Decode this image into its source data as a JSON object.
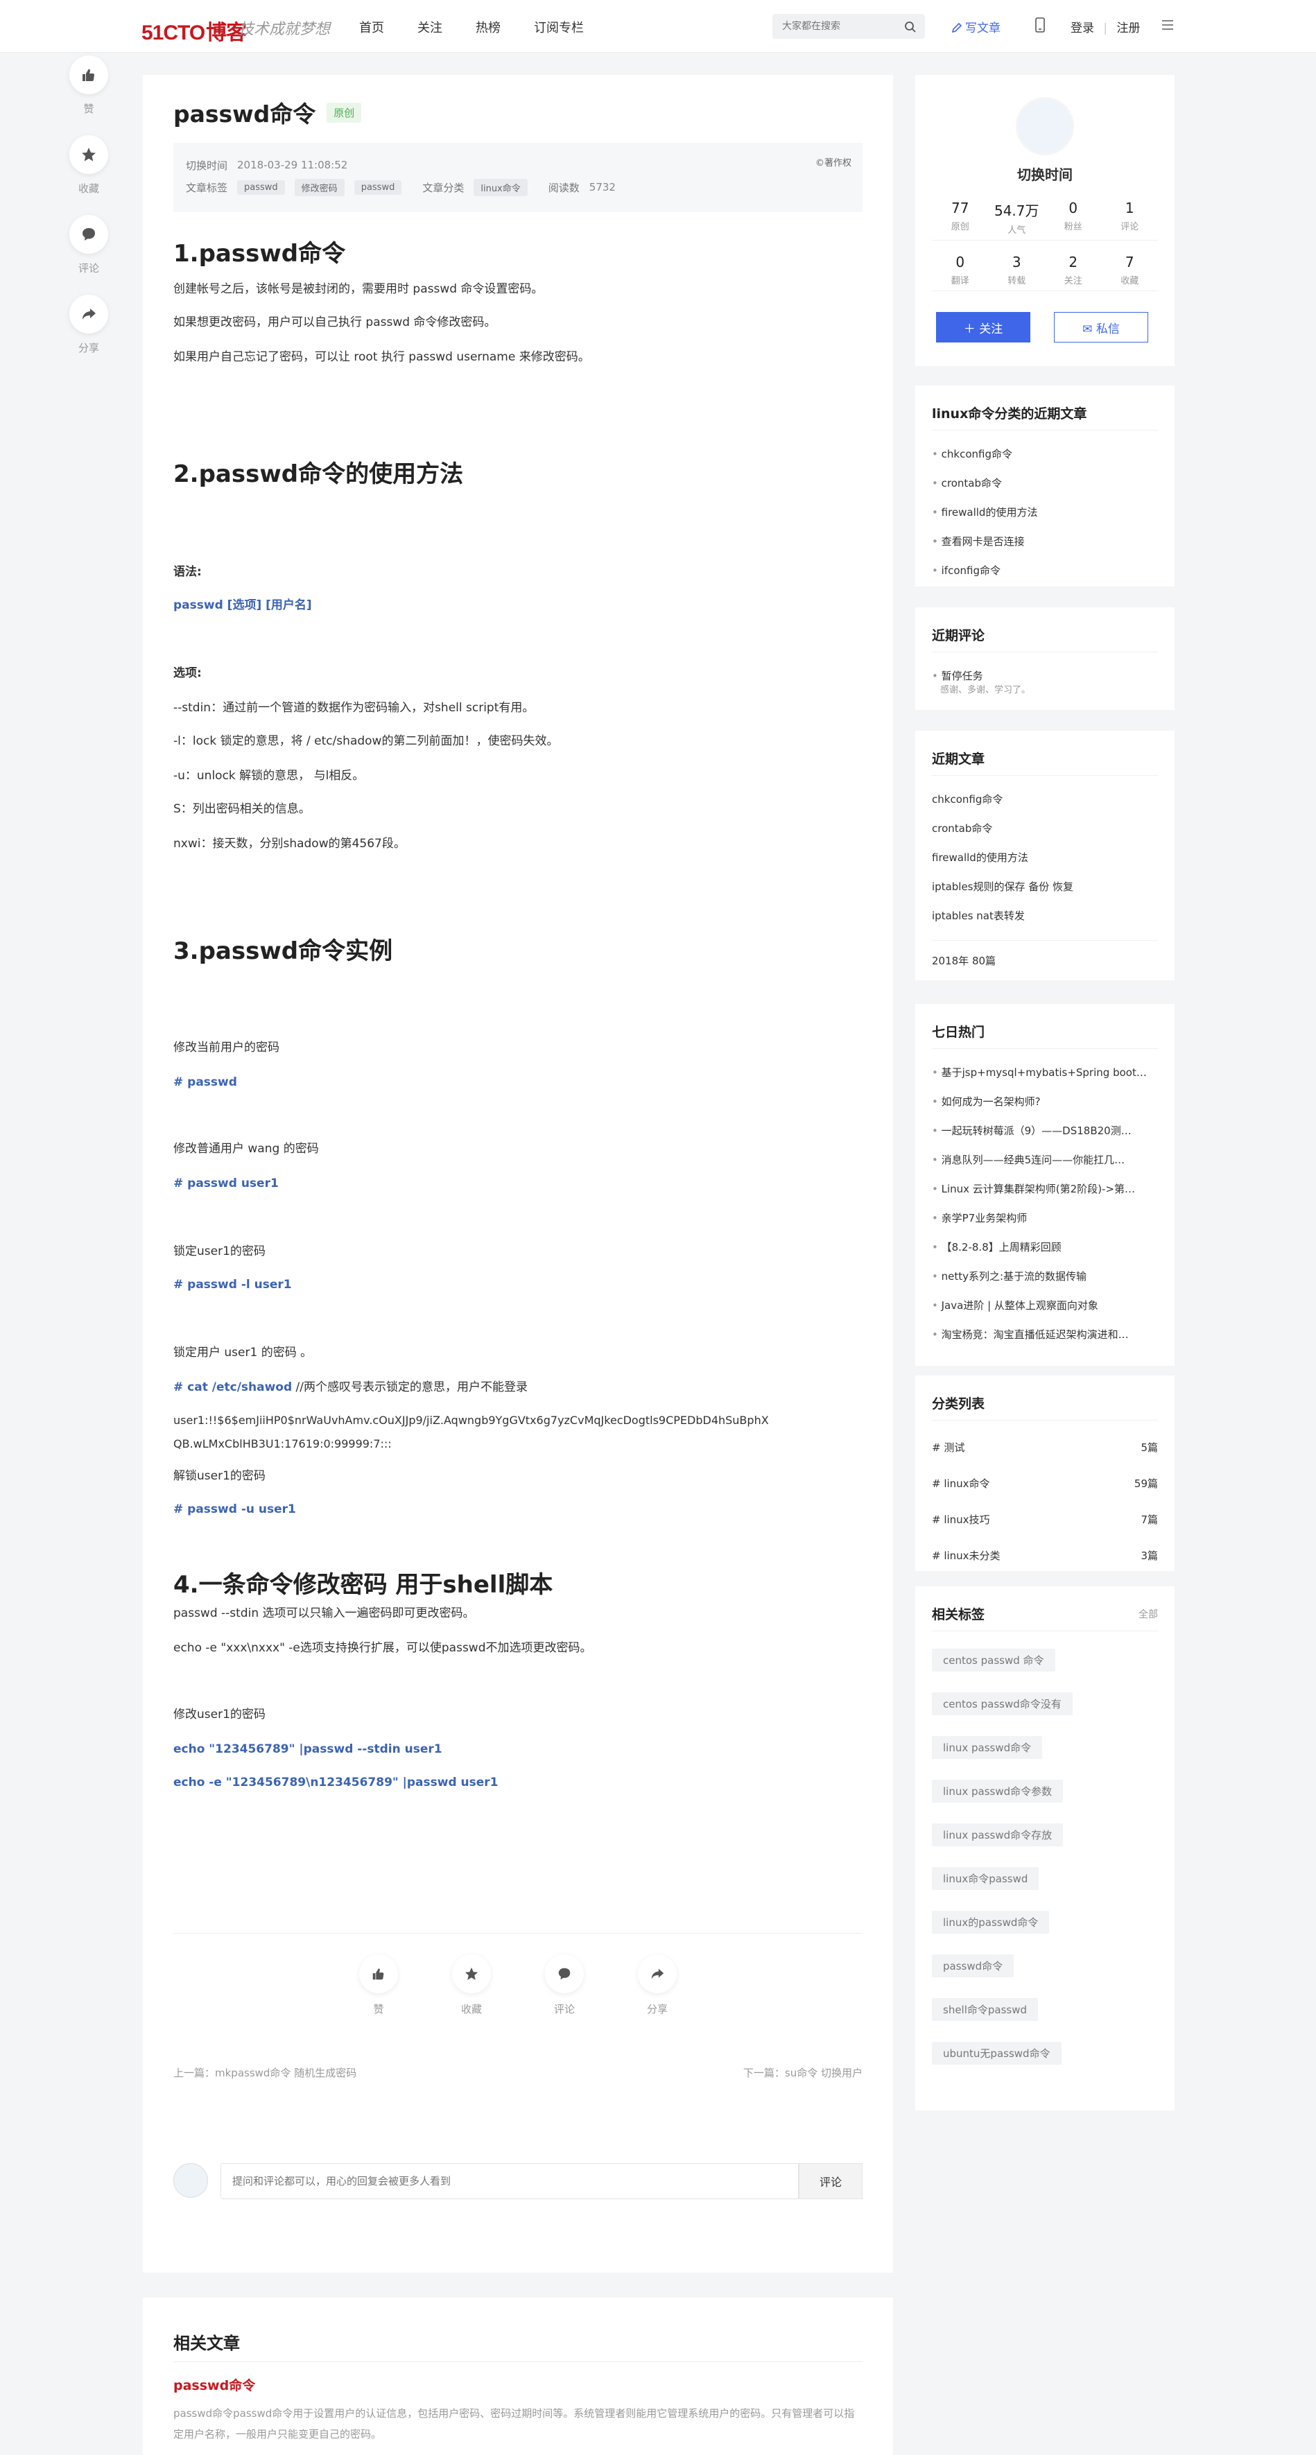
{
  "header": {
    "logo_text": "51CTO",
    "logo_suffix": "博客",
    "slogan": "技术成就梦想",
    "nav": [
      "首页",
      "关注",
      "热榜",
      "订阅专栏"
    ],
    "search_placeholder": "大家都在搜索",
    "write_label": "写文章",
    "login": "登录",
    "register": "注册"
  },
  "left_actions": [
    "赞",
    "收藏",
    "评论",
    "分享"
  ],
  "article": {
    "title": "passwd命令",
    "badge": "原创",
    "meta": {
      "time_label": "切换时间",
      "time_value": "2018-03-29 11:08:52",
      "copyright": "©著作权",
      "tags_label": "文章标签",
      "tags": [
        "passwd",
        "修改密码",
        "passwd"
      ],
      "category_label": "文章分类",
      "category": "linux命令",
      "reads_label": "阅读数",
      "reads": "5732"
    },
    "s1": {
      "h": "1.passwd命令",
      "p1": "创建帐号之后，该帐号是被封闭的，需要用时 passwd 命令设置密码。",
      "p2": "如果想更改密码，用户可以自己执行 passwd 命令修改密码。",
      "p3": "如果用户自己忘记了密码，可以让 root 执行 passwd username 来修改密码。"
    },
    "s2": {
      "h": "2.passwd命令的使用方法",
      "syntax_label": "语法:",
      "syntax": "passwd [选项] [用户名]",
      "options_label": "选项:",
      "o1": "--stdin：通过前一个管道的数据作为密码输入，对shell script有用。",
      "o2": "-l：lock 锁定的意思，将 / etc/shadow的第二列前面加！，使密码失效。",
      "o3": "-u：unlock 解锁的意思， 与l相反。",
      "o4": "S：列出密码相关的信息。",
      "o5": "nxwi：接天数，分别shadow的第4567段。"
    },
    "s3": {
      "h": "3.passwd命令实例",
      "e1": "修改当前用户的密码",
      "c1": "# passwd",
      "e2": "修改普通用户 wang 的密码",
      "c2": "# passwd user1",
      "e3": "锁定user1的密码",
      "c3": "# passwd -l user1",
      "e4": "锁定用户 user1 的密码 。",
      "c4": "# cat /etc/shawod",
      "c4_note": " //两个感叹号表示锁定的意思，用户不能登录",
      "hash1": "user1:!!$6$emJiiHP0$nrWaUvhAmv.cOuXJJp9/jiZ.Aqwngb9YgGVtx6g7yzCvMqJkecDogtls9CPEDbD4hSuBphX",
      "hash2": "QB.wLMxCblHB3U1:17619:0:99999:7:::",
      "e5": "解锁user1的密码",
      "c5": "# passwd -u user1"
    },
    "s4": {
      "h": "4.一条命令修改密码 用于shell脚本",
      "p1": "passwd --stdin 选项可以只输入一遍密码即可更改密码。",
      "p2": "echo -e \"xxx\\nxxx\" -e选项支持换行扩展，可以使passwd不加选项更改密码。",
      "e1": "修改user1的密码",
      "c1": "echo \"123456789\" |passwd --stdin user1",
      "c2": "echo -e \"123456789\\n123456789\" |passwd user1"
    },
    "actions": [
      "赞",
      "收藏",
      "评论",
      "分享"
    ],
    "prev": "上一篇：mkpasswd命令 随机生成密码",
    "next": "下一篇：su命令 切换用户"
  },
  "comment": {
    "placeholder": "提问和评论都可以，用心的回复会被更多人看到",
    "button": "评论"
  },
  "related": {
    "heading": "相关文章",
    "title": "passwd命令",
    "desc": "passwd命令passwd命令用于设置用户的认证信息，包括用户密码、密码过期时间等。系统管理者则能用它管理系统用户的密码。只有管理者可以指定用户名称，一般用户只能变更自己的密码。"
  },
  "profile": {
    "name": "切换时间",
    "stats1": [
      {
        "n": "77",
        "l": "原创"
      },
      {
        "n": "54.7万",
        "l": "人气"
      },
      {
        "n": "0",
        "l": "粉丝"
      },
      {
        "n": "1",
        "l": "评论"
      }
    ],
    "stats2": [
      {
        "n": "0",
        "l": "翻译"
      },
      {
        "n": "3",
        "l": "转载"
      },
      {
        "n": "2",
        "l": "关注"
      },
      {
        "n": "7",
        "l": "收藏"
      }
    ],
    "follow": "关注",
    "message": "私信"
  },
  "recent_in_cat": {
    "heading": "linux命令分类的近期文章",
    "items": [
      "chkconfig命令",
      "crontab命令",
      "firewalld的使用方法",
      "查看网卡是否连接",
      "ifconfig命令"
    ]
  },
  "recent_comments": {
    "heading": "近期评论",
    "title": "暂停任务",
    "text": "感谢、多谢、学习了。"
  },
  "recent_articles": {
    "heading": "近期文章",
    "items": [
      "chkconfig命令",
      "crontab命令",
      "firewalld的使用方法",
      "iptables规则的保存 备份 恢复",
      "iptables nat表转发"
    ],
    "archive": "2018年 80篇"
  },
  "hot7": {
    "heading": "七日热门",
    "items": [
      "基于jsp+mysql+mybatis+Spring boot…",
      "如何成为一名架构师?",
      "一起玩转树莓派（9）——DS18B20测…",
      "消息队列——经典5连问——你能扛几…",
      "Linux 云计算集群架构师(第2阶段)->第…",
      "亲学P7业务架构师",
      "【8.2-8.8】上周精彩回顾",
      "netty系列之:基于流的数据传输",
      "Java进阶 | 从整体上观察面向对象",
      "淘宝杨竞：淘宝直播低延迟架构演进和…"
    ]
  },
  "categories": {
    "heading": "分类列表",
    "items": [
      {
        "name": "# 测试",
        "count": "5篇"
      },
      {
        "name": "# linux命令",
        "count": "59篇"
      },
      {
        "name": "# linux技巧",
        "count": "7篇"
      },
      {
        "name": "# linux未分类",
        "count": "3篇"
      }
    ]
  },
  "tags_panel": {
    "heading": "相关标签",
    "all": "全部",
    "items": [
      "centos passwd 命令",
      "centos passwd命令没有",
      "linux passwd命令",
      "linux passwd命令参数",
      "linux passwd命令存放",
      "linux命令passwd",
      "linux的passwd命令",
      "passwd命令",
      "shell命令passwd",
      "ubuntu无passwd命令"
    ]
  }
}
